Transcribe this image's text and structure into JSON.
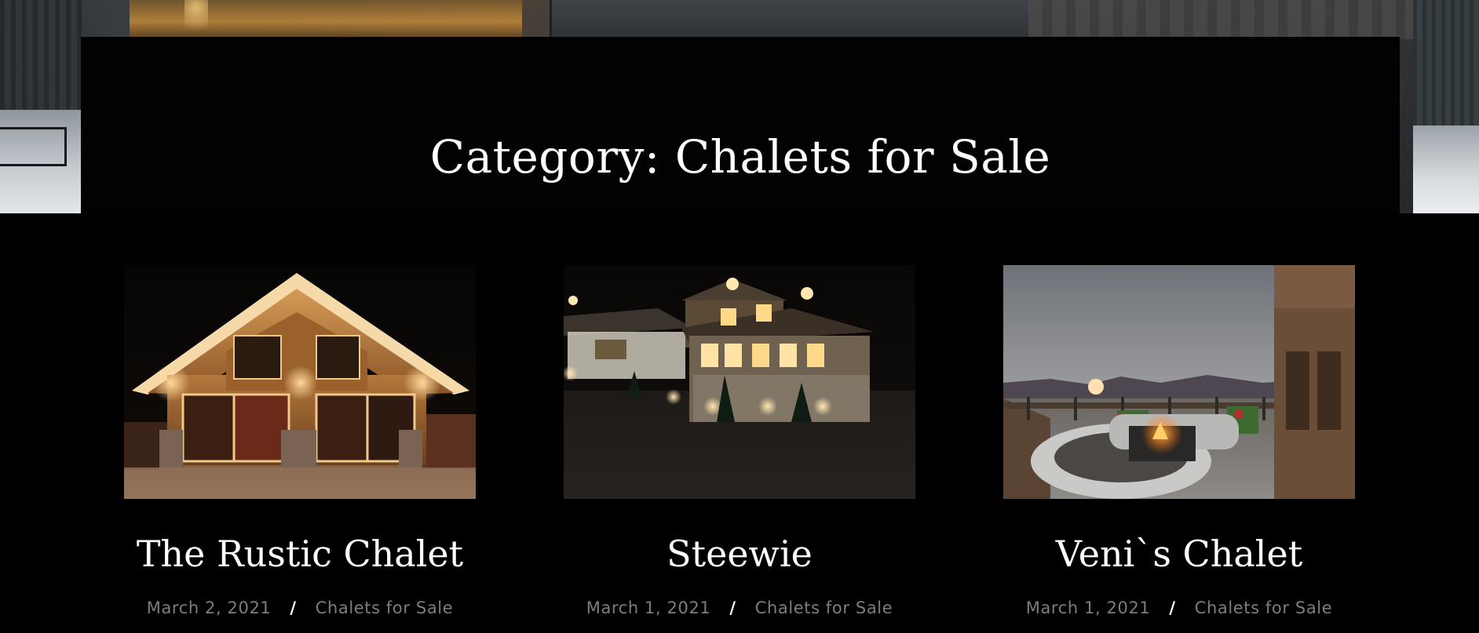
{
  "page": {
    "title": "Category: Chalets for Sale"
  },
  "posts": [
    {
      "title": "The Rustic Chalet",
      "date": "March 2, 2021",
      "separator": "/",
      "category": "Chalets for Sale",
      "image_icon": "chalet-photo-rustic"
    },
    {
      "title": "Steewie",
      "date": "March 1, 2021",
      "separator": "/",
      "category": "Chalets for Sale",
      "image_icon": "chalet-photo-night"
    },
    {
      "title": "Veni`s Chalet",
      "date": "March 1, 2021",
      "separator": "/",
      "category": "Chalets for Sale",
      "image_icon": "chalet-photo-terrace"
    }
  ],
  "colors": {
    "background": "#000000",
    "title_text": "#ffffff",
    "meta_text": "#7d7d7d",
    "separator": "#ffffff"
  }
}
